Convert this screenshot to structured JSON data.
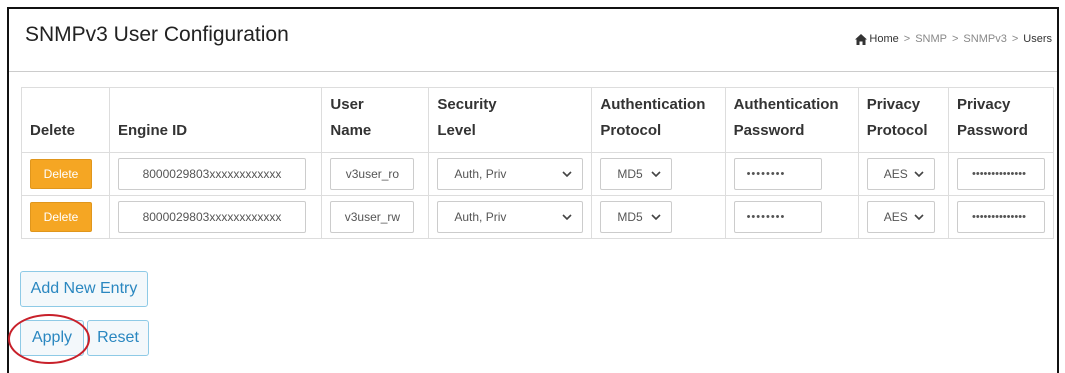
{
  "page": {
    "title": "SNMPv3 User Configuration"
  },
  "breadcrumb": {
    "home": "Home",
    "items": [
      "SNMP",
      "SNMPv3"
    ],
    "current": "Users",
    "separator": ">"
  },
  "table": {
    "headers": {
      "delete": "Delete",
      "engine_id": "Engine ID",
      "user_name_1": "User",
      "user_name_2": "Name",
      "security_level_1": "Security",
      "security_level_2": "Level",
      "auth_protocol_1": "Authentication",
      "auth_protocol_2": "Protocol",
      "auth_password_1": "Authentication",
      "auth_password_2": "Password",
      "priv_protocol_1": "Privacy",
      "priv_protocol_2": "Protocol",
      "priv_password_1": "Privacy",
      "priv_password_2": "Password"
    },
    "rows": [
      {
        "delete_label": "Delete",
        "engine_id": "8000029803xxxxxxxxxxxx",
        "user_name": "v3user_ro",
        "security_level": "Auth, Priv",
        "auth_protocol": "MD5",
        "auth_password": "••••••••",
        "priv_protocol": "AES",
        "priv_password": "••••••••••••••"
      },
      {
        "delete_label": "Delete",
        "engine_id": "8000029803xxxxxxxxxxxx",
        "user_name": "v3user_rw",
        "security_level": "Auth, Priv",
        "auth_protocol": "MD5",
        "auth_password": "••••••••",
        "priv_protocol": "AES",
        "priv_password": "••••••••••••••"
      }
    ]
  },
  "buttons": {
    "add_new_entry": "Add New Entry",
    "apply": "Apply",
    "reset": "Reset"
  },
  "colors": {
    "delete_button": "#f5a623",
    "outline_button_border": "#8ecae6",
    "outline_button_text": "#2a87c0",
    "annotation": "#c8202a"
  }
}
